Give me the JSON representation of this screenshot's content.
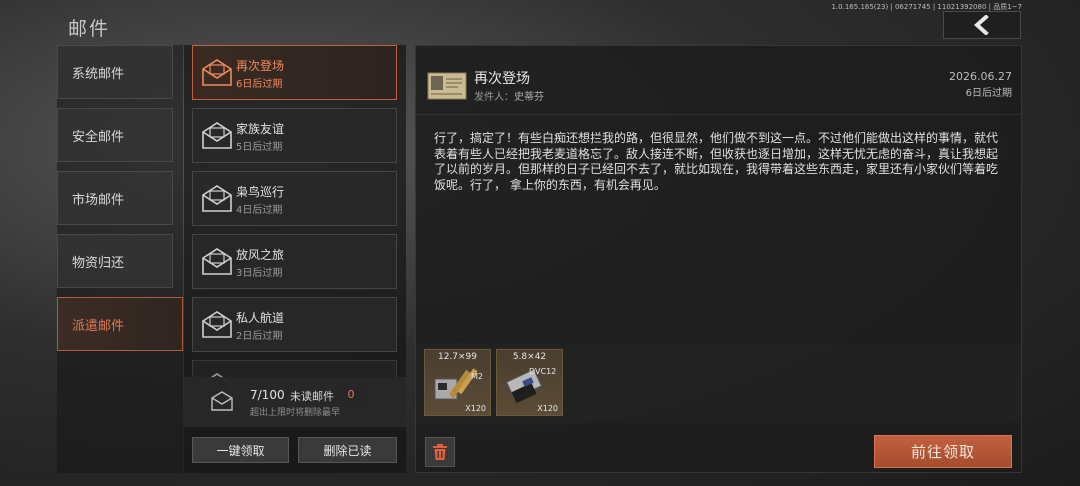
{
  "header": {
    "title": "邮件",
    "version": "1.0.165.165(23) | 06271745 | 11021392080 | 品质1~7",
    "back_icon": "chevron-left-icon"
  },
  "categories": [
    {
      "label": "系统邮件",
      "active": false
    },
    {
      "label": "安全邮件",
      "active": false
    },
    {
      "label": "市场邮件",
      "active": false
    },
    {
      "label": "物资归还",
      "active": false
    },
    {
      "label": "派遣邮件",
      "active": true
    }
  ],
  "mail_list": [
    {
      "title": "再次登场",
      "expire": "6日后过期",
      "active": true
    },
    {
      "title": "家族友谊",
      "expire": "5日后过期",
      "active": false
    },
    {
      "title": "枭鸟巡行",
      "expire": "4日后过期",
      "active": false
    },
    {
      "title": "放风之旅",
      "expire": "3日后过期",
      "active": false
    },
    {
      "title": "私人航道",
      "expire": "2日后过期",
      "active": false
    }
  ],
  "summary": {
    "count": "7/100",
    "unread_label": "未读邮件",
    "unread_count": "0",
    "limit_note": "超出上限时将删除最早"
  },
  "buttons": {
    "claim_all": "一键领取",
    "delete_read": "删除已读",
    "go_claim": "前往领取"
  },
  "detail": {
    "subject": "再次登场",
    "sender_label": "发件人：",
    "sender_name": "史蒂芬",
    "date": "2026.06.27",
    "expire": "6日后过期",
    "body": "行了，搞定了！有些白痴还想拦我的路，但很显然，他们做不到这一点。不过他们能做出这样的事情，就代表着有些人已经把我老麦道格忘了。敌人接连不断，但收获也逐日增加，这样无忧无虑的奋斗，真让我想起了以前的岁月。但那样的日子已经回不去了，就比如现在，我得带着这些东西走，家里还有小家伙们等着吃饭呢。行了， 拿上你的东西，有机会再见。",
    "attachments": [
      {
        "name": "12.7×99",
        "sub": "M2",
        "qty": "X120",
        "icon": "ammo-box-icon"
      },
      {
        "name": "5.8×42",
        "sub": "DVC12",
        "qty": "X120",
        "icon": "ammo-box-icon"
      }
    ]
  },
  "colors": {
    "accent": "#c0603f",
    "accent_text": "#e07a55",
    "panel": "#282828"
  }
}
